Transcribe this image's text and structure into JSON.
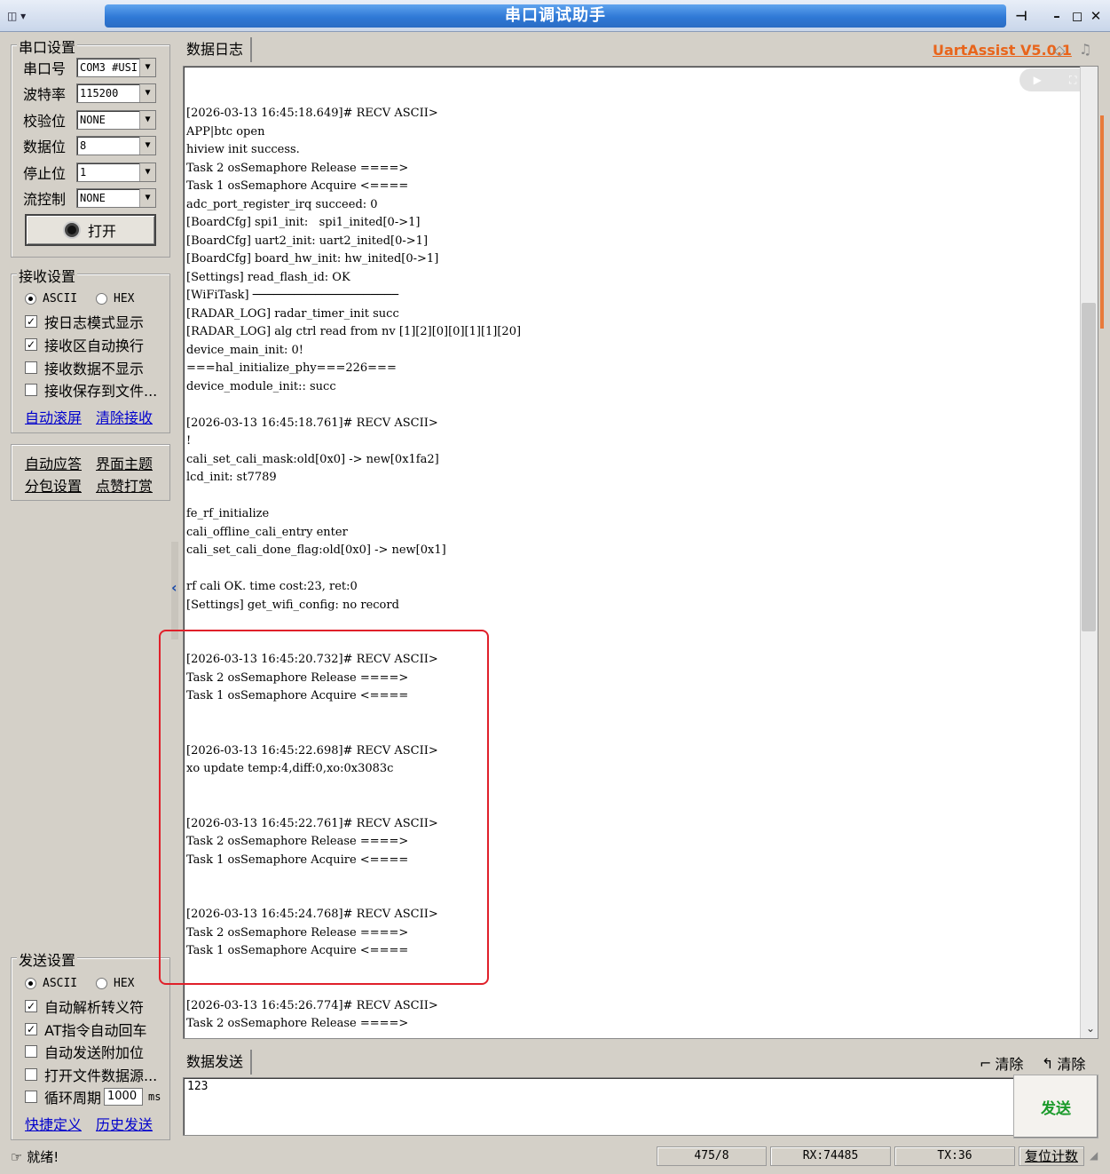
{
  "window": {
    "title": "串口调试助手",
    "sys_menu": "▾"
  },
  "serial": {
    "group_title": "串口设置",
    "port_label": "串口号",
    "port_value": "COM3 #USI",
    "baud_label": "波特率",
    "baud_value": "115200",
    "parity_label": "校验位",
    "parity_value": "NONE",
    "databits_label": "数据位",
    "databits_value": "8",
    "stopbits_label": "停止位",
    "stopbits_value": "1",
    "flow_label": "流控制",
    "flow_value": "NONE",
    "open_label": "打开"
  },
  "receive": {
    "group_title": "接收设置",
    "ascii": "ASCII",
    "hex": "HEX",
    "opt1": "按日志模式显示",
    "opt2": "接收区自动换行",
    "opt3": "接收数据不显示",
    "opt4": "接收保存到文件...",
    "link_autoscroll": "自动滚屏",
    "link_clear": "清除接收"
  },
  "misc": {
    "auto_reply": "自动应答",
    "theme": "界面主题",
    "packet": "分包设置",
    "reward": "点赞打赏"
  },
  "send": {
    "group_title": "发送设置",
    "ascii": "ASCII",
    "hex": "HEX",
    "opt1": "自动解析转义符",
    "opt2": "AT指令自动回车",
    "opt3": "自动发送附加位",
    "opt4": "打开文件数据源...",
    "cycle_label": "循环周期",
    "cycle_value": "1000",
    "cycle_unit": "ms",
    "link_shortcut": "快捷定义",
    "link_history": "历史发送",
    "tab": "数据发送",
    "text": "123",
    "send_button": "发送",
    "clear1": "清除",
    "clear2": "清除"
  },
  "log": {
    "tab": "数据日志",
    "brand": "UartAssist V5.0.1",
    "lines": [
      "[2026-03-13 16:45:18.649]# RECV ASCII>",
      "APP|btc open",
      "hiview init success.",
      "Task 2 osSemaphore Release ====>",
      "Task 1 osSemaphore Acquire <====",
      "adc_port_register_irq succeed: 0",
      "[BoardCfg] spi1_init:   spi1_inited[0->1]",
      "[BoardCfg] uart2_init: uart2_inited[0->1]",
      "[BoardCfg] board_hw_init: hw_inited[0->1]",
      "[Settings] read_flash_id: OK",
      "[WiFiTask] ─────────────────────",
      "[RADAR_LOG] radar_timer_init succ",
      "[RADAR_LOG] alg ctrl read from nv [1][2][0][0][1][1][20]",
      "device_main_init: 0!",
      "===hal_initialize_phy===226===",
      "device_module_init:: succ",
      "",
      "[2026-03-13 16:45:18.761]# RECV ASCII>",
      "!",
      "cali_set_cali_mask:old[0x0] -> new[0x1fa2]",
      "lcd_init: st7789",
      "",
      "fe_rf_initialize",
      "cali_offline_cali_entry enter",
      "cali_set_cali_done_flag:old[0x0] -> new[0x1]",
      "",
      "rf cali OK. time cost:23, ret:0",
      "[Settings] get_wifi_config: no record",
      "",
      "",
      "[2026-03-13 16:45:20.732]# RECV ASCII>",
      "Task 2 osSemaphore Release ====>",
      "Task 1 osSemaphore Acquire <====",
      "",
      "",
      "[2026-03-13 16:45:22.698]# RECV ASCII>",
      "xo update temp:4,diff:0,xo:0x3083c",
      "",
      "",
      "[2026-03-13 16:45:22.761]# RECV ASCII>",
      "Task 2 osSemaphore Release ====>",
      "Task 1 osSemaphore Acquire <====",
      "",
      "",
      "[2026-03-13 16:45:24.768]# RECV ASCII>",
      "Task 2 osSemaphore Release ====>",
      "Task 1 osSemaphore Acquire <====",
      "",
      "",
      "[2026-03-13 16:45:26.774]# RECV ASCII>",
      "Task 2 osSemaphore Release ====>"
    ]
  },
  "status": {
    "ready": "就绪!",
    "pos": "475/8",
    "rx": "RX:74485",
    "tx": "TX:36",
    "reset": "复位计数"
  },
  "colors": {
    "title_strip": "#2f79d6",
    "highlight_box": "#e0202a",
    "brand": "#e8651c",
    "send_button": "#1a9a2a"
  }
}
